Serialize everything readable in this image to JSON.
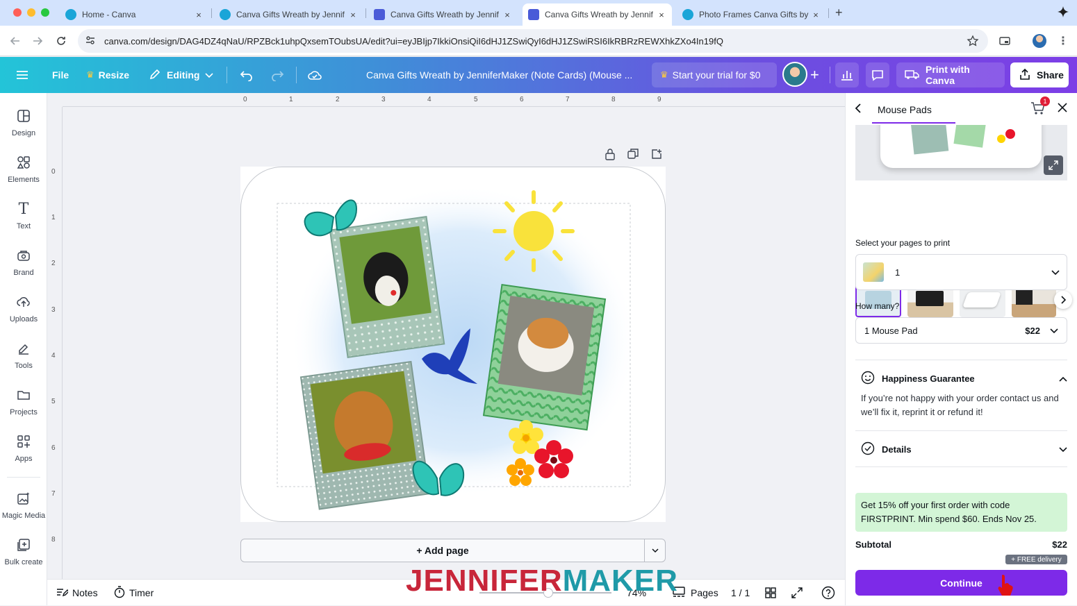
{
  "browser": {
    "tabs": [
      {
        "title": "Home - Canva",
        "active": false
      },
      {
        "title": "Canva Gifts Wreath by Jennif",
        "active": false
      },
      {
        "title": "Canva Gifts Wreath by Jennif",
        "active": false
      },
      {
        "title": "Canva Gifts Wreath by Jennif",
        "active": true
      },
      {
        "title": "Photo Frames Canva Gifts by",
        "active": false
      }
    ],
    "new_tab": "+",
    "close": "×",
    "url": "canva.com/design/DAG4DZ4qNaU/RPZBck1uhpQxsemTOubsUA/edit?ui=eyJBIjp7IkkiOnsiQiI6dHJ1ZSwiQyI6dHJ1ZSwiRSI6IkRBRzREWXhkZXo4In19fQ"
  },
  "header": {
    "file": "File",
    "resize": "Resize",
    "editing": "Editing",
    "title": "Canva Gifts Wreath by JenniferMaker (Note Cards) (Mouse ...",
    "trial": "Start your trial for $0",
    "print": "Print with Canva",
    "share": "Share"
  },
  "sidebar": {
    "items": [
      {
        "label": "Design"
      },
      {
        "label": "Elements"
      },
      {
        "label": "Text"
      },
      {
        "label": "Brand"
      },
      {
        "label": "Uploads"
      },
      {
        "label": "Tools"
      },
      {
        "label": "Projects"
      },
      {
        "label": "Apps"
      },
      {
        "label": "Magic Media"
      },
      {
        "label": "Bulk create"
      }
    ]
  },
  "ruler": {
    "top": [
      "0",
      "1",
      "2",
      "3",
      "4",
      "5",
      "6",
      "7",
      "8",
      "9"
    ],
    "left": [
      "0",
      "1",
      "2",
      "3",
      "4",
      "5",
      "6",
      "7",
      "8"
    ]
  },
  "canvas": {
    "add_page": "+ Add page"
  },
  "bottombar": {
    "notes": "Notes",
    "timer": "Timer",
    "zoom": "74%",
    "pages": "Pages",
    "page_count": "1 / 1"
  },
  "panel": {
    "title": "Mouse Pads",
    "cart_count": "1",
    "select_pages_label": "Select your pages to print",
    "selected_page": "1",
    "how_many_label": "How many?",
    "quantity": "1 Mouse Pad",
    "price": "$22",
    "guarantee_title": "Happiness Guarantee",
    "guarantee_text": "If you’re not happy with your order contact us and we’ll fix it, reprint it or refund it!",
    "details_title": "Details",
    "promo": "Get 15% off your first order with code FIRSTPRINT. Min spend $60. Ends Nov 25.",
    "subtotal_label": "Subtotal",
    "subtotal_value": "$22",
    "free_delivery": "+ FREE delivery",
    "continue": "Continue"
  },
  "watermark": {
    "part1": "JENNIFER",
    "part2": "MAKER"
  },
  "colors": {
    "accent": "#7d2ae8",
    "watermark_red": "#c8263a",
    "watermark_teal": "#1f9aa8",
    "promo_bg": "#d3f5d6"
  }
}
